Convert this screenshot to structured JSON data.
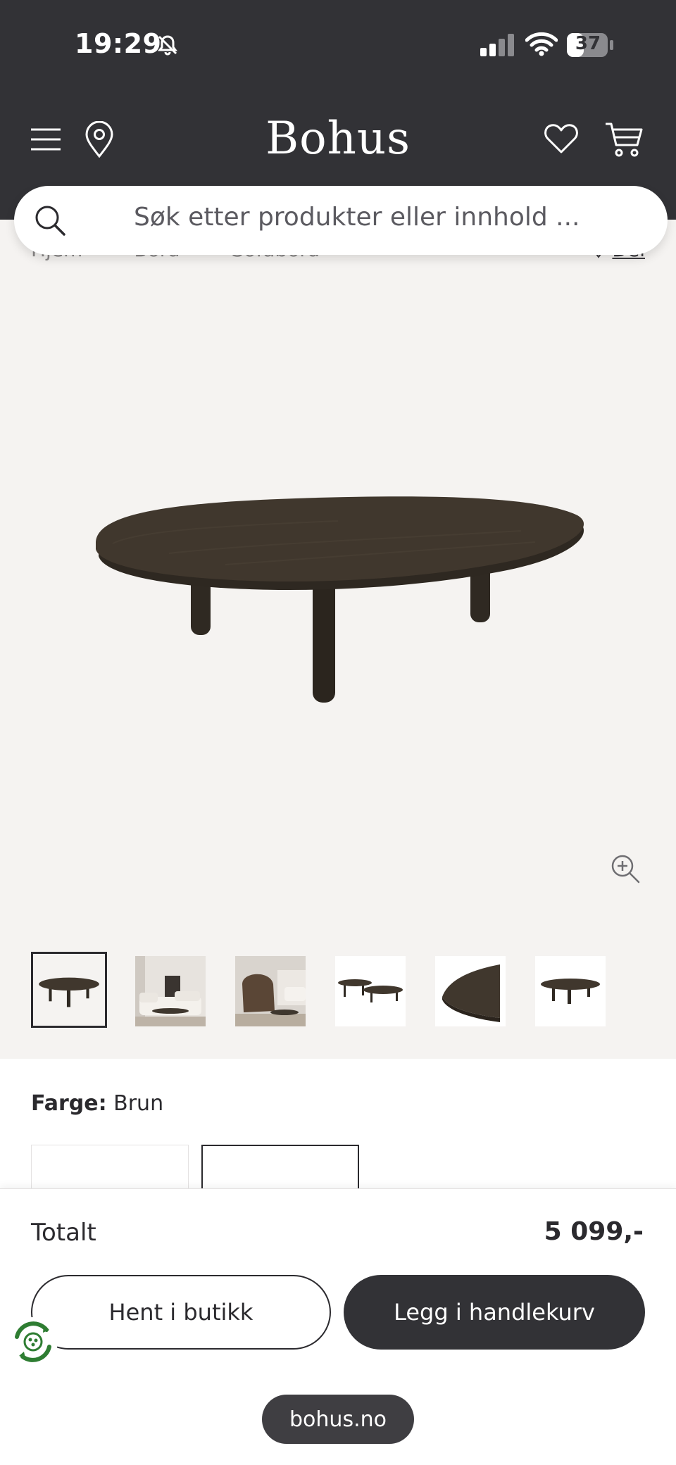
{
  "status_bar": {
    "time": "19:29",
    "battery": "37"
  },
  "header": {
    "logo": "Bohus"
  },
  "search": {
    "placeholder": "Søk etter produkter eller innhold ..."
  },
  "breadcrumb": {
    "items": [
      "Hjem",
      "Bord",
      "Sofabord"
    ],
    "share_label": "Del"
  },
  "colors": {
    "header_bg": "#323236",
    "gallery_bg": "#f5f3f1",
    "wood": "#3a3128",
    "accent": "#2b2a2e"
  },
  "gallery": {
    "thumbnail_count": 6,
    "active_index": 0
  },
  "product": {
    "color_label": "Farge:",
    "color_value": "Brun"
  },
  "cart": {
    "total_label": "Totalt",
    "total_price": "5 099,-",
    "pickup_button": "Hent i butikk",
    "add_button": "Legg i handlekurv"
  },
  "browser": {
    "url": "bohus.no"
  }
}
